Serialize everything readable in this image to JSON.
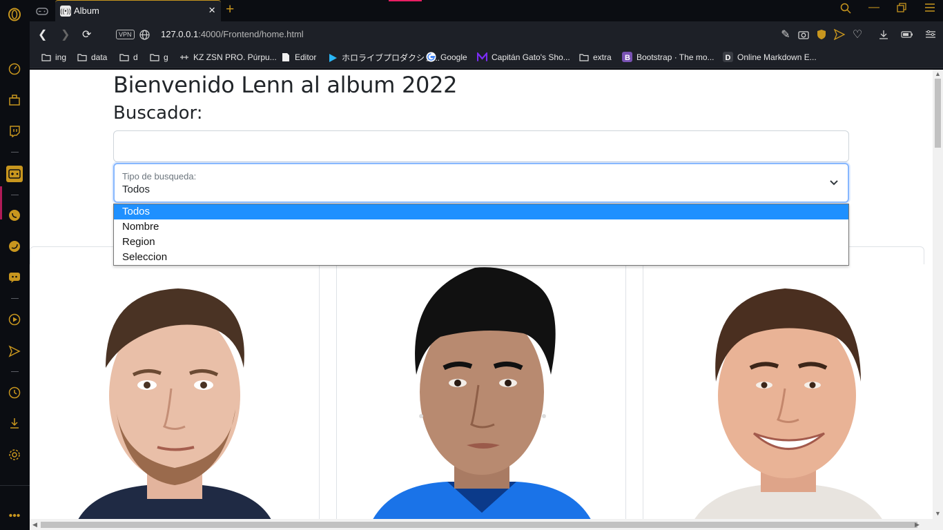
{
  "browser": {
    "tab_title": "Album",
    "url_host": "127.0.0.1",
    "url_path": ":4000/Frontend/home.html",
    "vpn_label": "VPN",
    "accent": "#c8961e"
  },
  "bookmarks": [
    {
      "label": "ing",
      "icon": "folder-icon"
    },
    {
      "label": "data",
      "icon": "folder-icon"
    },
    {
      "label": "d",
      "icon": "folder-icon"
    },
    {
      "label": "g",
      "icon": "folder-icon"
    },
    {
      "label": "KZ ZSN PRO. Púrpu...",
      "icon": "site-icon"
    },
    {
      "label": "Editor",
      "icon": "page-icon"
    },
    {
      "label": "ホロライブプロダクショ...",
      "icon": "play-icon"
    },
    {
      "label": "Google",
      "icon": "google-icon"
    },
    {
      "label": "Capitán Gato's Sho...",
      "icon": "m-icon"
    },
    {
      "label": "extra",
      "icon": "folder-icon"
    },
    {
      "label": "Bootstrap · The mo...",
      "icon": "bootstrap-icon"
    },
    {
      "label": "Online Markdown E...",
      "icon": "d-icon"
    }
  ],
  "page": {
    "title": "Bienvenido Lenn al album 2022",
    "search_heading": "Buscador:",
    "search_value": "",
    "select_label": "Tipo de busqueda:",
    "select_value": "Todos",
    "options": [
      "Todos",
      "Nombre",
      "Region",
      "Seleccion"
    ],
    "selected_option": "Todos"
  },
  "cards": [
    {
      "name": "player-card-1",
      "shirt": "#1f2a44"
    },
    {
      "name": "player-card-2",
      "shirt": "#1a73e8"
    },
    {
      "name": "player-card-3",
      "shirt": "#e8e4df"
    }
  ]
}
